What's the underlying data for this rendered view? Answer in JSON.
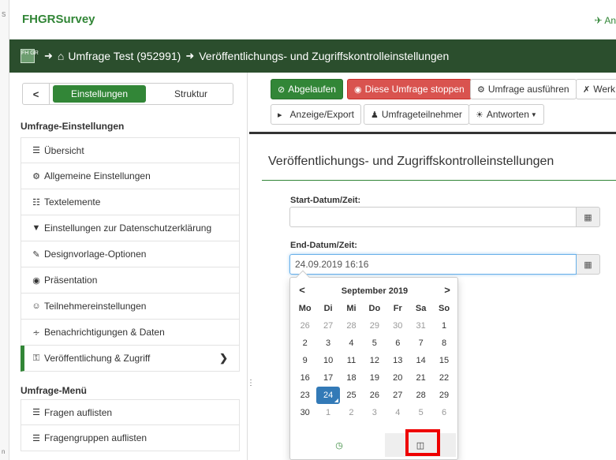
{
  "window": {
    "edge_chars": [
      "S",
      "n"
    ]
  },
  "topbar": {
    "brand": "FHGRSurvey",
    "right_text": "✈ An",
    "accent": "#328637"
  },
  "breadcrumb": {
    "logo_text": "FH GR",
    "home_icon": "home-icon",
    "survey": "Umfrage Test (952991)",
    "page": "Veröffentlichungs- und Zugriffskontrolleinstellungen"
  },
  "sidebar": {
    "back_label": "<",
    "tab_active": "Einstellungen",
    "tab_other": "Struktur",
    "settings_header": "Umfrage-Einstellungen",
    "settings_items": [
      {
        "icon": "list-icon",
        "glyph": "☰",
        "label": "Übersicht"
      },
      {
        "icon": "gears-icon",
        "glyph": "⚙",
        "label": "Allgemeine Einstellungen"
      },
      {
        "icon": "file-text-icon",
        "glyph": "☷",
        "label": "Textelemente"
      },
      {
        "icon": "shield-icon",
        "glyph": "▼",
        "label": "Einstellungen zur Datenschutzerklärung"
      },
      {
        "icon": "brush-icon",
        "glyph": "✎",
        "label": "Designvorlage-Optionen"
      },
      {
        "icon": "eye-slash-icon",
        "glyph": "◉",
        "label": "Präsentation"
      },
      {
        "icon": "users-icon",
        "glyph": "☺",
        "label": "Teilnehmereinstellungen"
      },
      {
        "icon": "rss-icon",
        "glyph": ")",
        "label": "Benachrichtigungen & Daten"
      },
      {
        "icon": "key-icon",
        "glyph": "⚿",
        "label": "Veröffentlichung & Zugriff"
      }
    ],
    "menu_header": "Umfrage-Menü",
    "menu_items": [
      {
        "icon": "list-icon",
        "glyph": "☰",
        "label": "Fragen auflisten"
      },
      {
        "icon": "list-icon",
        "glyph": "☰",
        "label": "Fragengruppen auflisten"
      }
    ],
    "handle_glyph": "⋮"
  },
  "toolbar": {
    "activate_label": "Abgelaufen",
    "stop_label": "Diese Umfrage stoppen",
    "run_label": "Umfrage ausführen",
    "tools_label": "Werk",
    "display_label": "Anzeige/Export",
    "participants_label": "Umfrageteilnehmer",
    "responses_label": "Antworten"
  },
  "form": {
    "title": "Veröffentlichungs- und Zugriffskontrolleinstellungen",
    "start_label": "Start-Datum/Zeit:",
    "start_value": "",
    "end_label": "End-Datum/Zeit:",
    "end_value": "24.09.2019 16:16"
  },
  "datepicker": {
    "prev": "<",
    "next": ">",
    "month_title": "September 2019",
    "weekdays": [
      "Mo",
      "Di",
      "Mi",
      "Do",
      "Fr",
      "Sa",
      "So"
    ],
    "weeks": [
      [
        [
          "26",
          1
        ],
        [
          "27",
          1
        ],
        [
          "28",
          1
        ],
        [
          "29",
          1
        ],
        [
          "30",
          1
        ],
        [
          "31",
          1
        ],
        [
          "1",
          0
        ]
      ],
      [
        [
          "2",
          0
        ],
        [
          "3",
          0
        ],
        [
          "4",
          0
        ],
        [
          "5",
          0
        ],
        [
          "6",
          0
        ],
        [
          "7",
          0
        ],
        [
          "8",
          0
        ]
      ],
      [
        [
          "9",
          0
        ],
        [
          "10",
          0
        ],
        [
          "11",
          0
        ],
        [
          "12",
          0
        ],
        [
          "13",
          0
        ],
        [
          "14",
          0
        ],
        [
          "15",
          0
        ]
      ],
      [
        [
          "16",
          0
        ],
        [
          "17",
          0
        ],
        [
          "18",
          0
        ],
        [
          "19",
          0
        ],
        [
          "20",
          0
        ],
        [
          "21",
          0
        ],
        [
          "22",
          0
        ]
      ],
      [
        [
          "23",
          0
        ],
        [
          "24",
          2
        ],
        [
          "25",
          0
        ],
        [
          "26",
          0
        ],
        [
          "27",
          0
        ],
        [
          "28",
          0
        ],
        [
          "29",
          0
        ]
      ],
      [
        [
          "30",
          0
        ],
        [
          "1",
          1
        ],
        [
          "2",
          1
        ],
        [
          "3",
          1
        ],
        [
          "4",
          1
        ],
        [
          "5",
          1
        ],
        [
          "6",
          1
        ]
      ]
    ],
    "selected_color": "#337ab7",
    "highlight_color": "#e00000"
  }
}
